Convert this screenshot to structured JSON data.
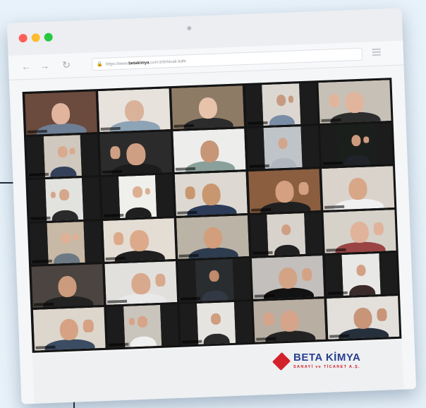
{
  "browser": {
    "url_prefix": "https://www.",
    "url_host": "betakimya",
    "url_suffix": ".com.tr/tr/sicak-kafe",
    "nav": {
      "back": "←",
      "forward": "→",
      "reload": "↻"
    },
    "lock_icon": "lock-icon",
    "window_dots": [
      "#ff5f57",
      "#febc2e",
      "#28c840"
    ]
  },
  "meeting": {
    "layout": "gallery-view",
    "columns": 5,
    "rows": 6,
    "tiles": [
      {
        "bg": "#6b4b3e",
        "skin": "#e1b49d",
        "shirt": "#6e7f95",
        "wide": true,
        "wave": false
      },
      {
        "bg": "#e7e2dc",
        "skin": "#d9b299",
        "shirt": "#8da3b6",
        "wide": true,
        "wave": false
      },
      {
        "bg": "#8e7b66",
        "skin": "#e6c3aa",
        "shirt": "#2c2c2c",
        "wide": true,
        "wave": false
      },
      {
        "bg": "#dcd7d1",
        "skin": "#c69a81",
        "shirt": "#7a8da6",
        "wide": false,
        "wave": true
      },
      {
        "bg": "#c7c0b6",
        "skin": "#e1b59c",
        "shirt": "#2d2d2d",
        "wide": true,
        "wave": true
      },
      {
        "bg": "#cfc8be",
        "skin": "#d9aa8d",
        "shirt": "#34405a",
        "wide": false,
        "wave": true
      },
      {
        "bg": "#2b2b2b",
        "skin": "#cf9f84",
        "shirt": "#1c1c1c",
        "wide": true,
        "wave": true
      },
      {
        "bg": "#ededec",
        "skin": "#c69677",
        "shirt": "#8aa09a",
        "wide": true,
        "wave": false
      },
      {
        "bg": "#bfc4c8",
        "skin": "#d2a68c",
        "shirt": "#b0b6bd",
        "wide": false,
        "wave": false
      },
      {
        "bg": "#1b1f1c",
        "skin": "#cc9b7e",
        "shirt": "#20232a",
        "wide": false,
        "wave": true
      },
      {
        "bg": "#e2e2df",
        "skin": "#d6a68b",
        "shirt": "#2a2a2a",
        "wide": false,
        "wave": true
      },
      {
        "bg": "#efefeb",
        "skin": "#dcae92",
        "shirt": "#1f1f1f",
        "wide": false,
        "wave": true
      },
      {
        "bg": "#ddd9d2",
        "skin": "#c9976f",
        "shirt": "#2b3b58",
        "wide": true,
        "wave": true
      },
      {
        "bg": "#8b5e40",
        "skin": "#d4a081",
        "shirt": "#202020",
        "wide": true,
        "wave": true
      },
      {
        "bg": "#d9d3cc",
        "skin": "#d8a788",
        "shirt": "#f0f0f0",
        "wide": true,
        "wave": false
      },
      {
        "bg": "#c8b9a6",
        "skin": "#dfb095",
        "shirt": "#6d7a86",
        "wide": false,
        "wave": true
      },
      {
        "bg": "#e4ddd4",
        "skin": "#dcaa8b",
        "shirt": "#1f1f1f",
        "wide": true,
        "wave": true
      },
      {
        "bg": "#bbb3a6",
        "skin": "#d39e7c",
        "shirt": "#2e3c4f",
        "wide": true,
        "wave": false
      },
      {
        "bg": "#d7d2cb",
        "skin": "#cf9e83",
        "shirt": "#202020",
        "wide": false,
        "wave": false
      },
      {
        "bg": "#d6d1c9",
        "skin": "#e0b39a",
        "shirt": "#9a4444",
        "wide": true,
        "wave": true
      },
      {
        "bg": "#4b4440",
        "skin": "#cc9a7c",
        "shirt": "#222222",
        "wide": true,
        "wave": false
      },
      {
        "bg": "#e2e0dc",
        "skin": "#d8a98c",
        "shirt": "#e9e9e9",
        "wide": true,
        "wave": true
      },
      {
        "bg": "#2a2d30",
        "skin": "#bf8b6c",
        "shirt": "#333944",
        "wide": false,
        "wave": false
      },
      {
        "bg": "#c2bfbd",
        "skin": "#d3a386",
        "shirt": "#121212",
        "wide": true,
        "wave": true
      },
      {
        "bg": "#e8e8e6",
        "skin": "#d3a083",
        "shirt": "#3a2a2a",
        "wide": false,
        "wave": false
      },
      {
        "bg": "#dcd6cd",
        "skin": "#d6a283",
        "shirt": "#3b4c63",
        "wide": true,
        "wave": true
      },
      {
        "bg": "#c9c4bc",
        "skin": "#d7a487",
        "shirt": "#f0f0f0",
        "wide": false,
        "wave": true
      },
      {
        "bg": "#e6e4e1",
        "skin": "#cf9e7f",
        "shirt": "#2a2a2a",
        "wide": false,
        "wave": false
      },
      {
        "bg": "#b9aea2",
        "skin": "#d5a48a",
        "shirt": "#232323",
        "wide": true,
        "wave": true
      },
      {
        "bg": "#e3e0dc",
        "skin": "#c89579",
        "shirt": "#26303c",
        "wide": true,
        "wave": true
      }
    ]
  },
  "brand": {
    "name": "BETA KİMYA",
    "tagline": "SANAYİ ve TİCARET A.Ş.",
    "logo_icon": "beta-kimya-logo-icon",
    "colors": {
      "blue": "#2a3f8f",
      "red": "#d3212b"
    }
  }
}
